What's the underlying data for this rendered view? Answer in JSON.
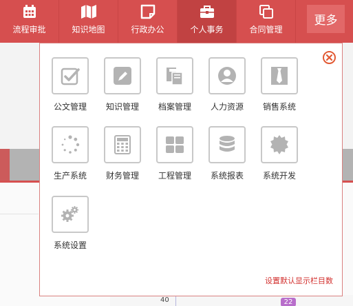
{
  "nav": {
    "items": [
      {
        "label": "流程审批",
        "icon": "calendar-icon"
      },
      {
        "label": "知识地图",
        "icon": "map-icon"
      },
      {
        "label": "行政办公",
        "icon": "note-icon"
      },
      {
        "label": "个人事务",
        "icon": "briefcase-icon"
      },
      {
        "label": "合同管理",
        "icon": "copy-icon"
      }
    ],
    "active_index": 3,
    "more_label": "更多"
  },
  "dropdown": {
    "tiles": [
      {
        "label": "公文管理",
        "icon": "checkbox-icon"
      },
      {
        "label": "知识管理",
        "icon": "edit-icon"
      },
      {
        "label": "档案管理",
        "icon": "documents-icon"
      },
      {
        "label": "人力资源",
        "icon": "user-icon"
      },
      {
        "label": "销售系统",
        "icon": "tie-icon"
      },
      {
        "label": "生产系统",
        "icon": "loading-icon"
      },
      {
        "label": "财务管理",
        "icon": "calculator-icon"
      },
      {
        "label": "工程管理",
        "icon": "grid-icon"
      },
      {
        "label": "系统报表",
        "icon": "database-icon"
      },
      {
        "label": "系统开发",
        "icon": "badge-icon"
      },
      {
        "label": "系统设置",
        "icon": "gears-icon"
      }
    ],
    "footer_link": "设置默认显示栏目数",
    "close_icon": "close-circle-icon"
  },
  "background": {
    "axis_label": "40",
    "badge_value": "22"
  },
  "colors": {
    "brand": "#d64f4f",
    "active_nav": "#c14242",
    "more_button": "#e26868",
    "link": "#d2302e",
    "icon_gray": "#b3b3b3"
  }
}
